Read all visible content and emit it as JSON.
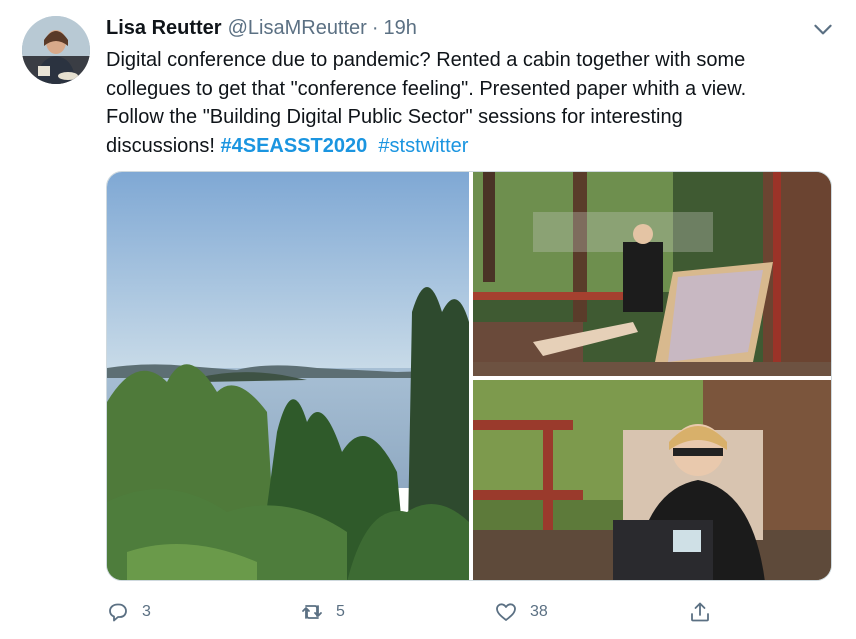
{
  "tweet": {
    "author_name": "Lisa Reutter",
    "handle": "@LisaMReutter",
    "separator": "·",
    "time": "19h",
    "text": {
      "line1": "Digital conference due to pandemic? Rented a cabin together with some",
      "line2": "collegues to get that \"conference feeling\". Presented paper whith a view.",
      "line3": "Follow the \"Building Digital Public Sector\" sessions for interesting",
      "line4_prefix": "discussions!",
      "hashtag1": "#4SEASST2020",
      "hashtag2": "#ststwitter"
    },
    "media": [
      {
        "name": "lake-view-photo"
      },
      {
        "name": "porch-photo"
      },
      {
        "name": "laptop-selfie-photo"
      }
    ],
    "actions": {
      "replies": "3",
      "retweets": "5",
      "likes": "38"
    }
  },
  "icons": {
    "menu": "chevron-down-icon",
    "reply": "reply-icon",
    "retweet": "retweet-icon",
    "like": "heart-icon",
    "share": "share-icon"
  },
  "colors": {
    "hashtag": "#1b95e0",
    "secondary_text": "#5b7083",
    "primary_text": "#0f1419"
  }
}
